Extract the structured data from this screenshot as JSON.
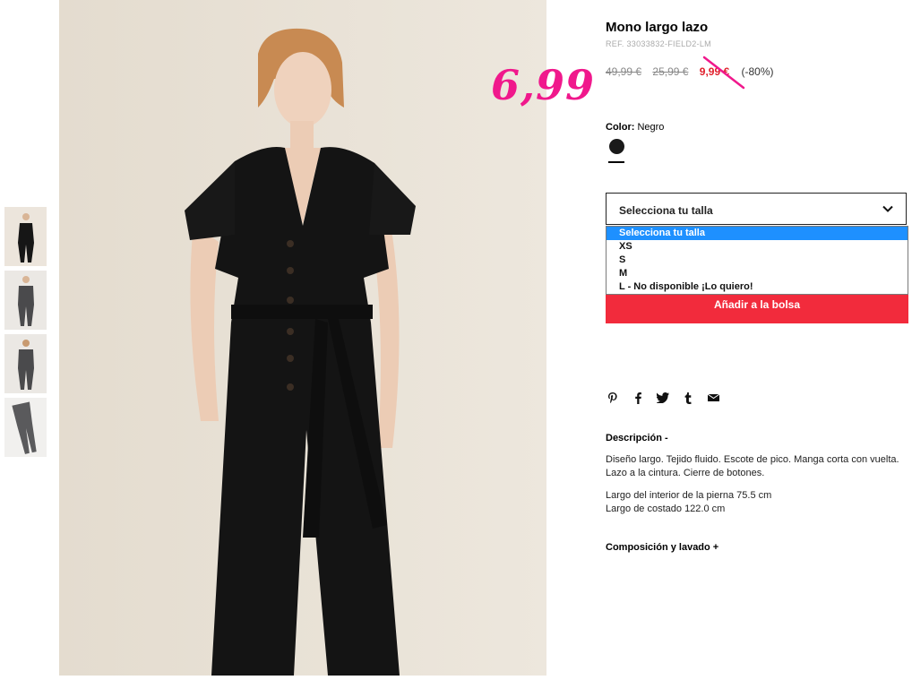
{
  "promo": {
    "price": "6,99"
  },
  "product": {
    "title": "Mono largo lazo",
    "ref": "REF. 33033832-FIELD2-LM",
    "prices": {
      "original": "49,99 €",
      "previous": "25,99 €",
      "current": "9,99 €",
      "discount": "(-80%)"
    },
    "color": {
      "label": "Color:",
      "value": "Negro",
      "swatch": "#1a1a1a"
    }
  },
  "size_select": {
    "placeholder": "Selecciona tu talla",
    "options": [
      "Selecciona tu talla",
      "XS",
      "S",
      "M",
      "L - No disponible ¡Lo quiero!"
    ]
  },
  "add_to_bag": "Añadir a la bolsa",
  "share_icons": [
    "pinterest-icon",
    "facebook-icon",
    "twitter-icon",
    "tumblr-icon",
    "email-icon"
  ],
  "description": {
    "heading": "Descripción -",
    "text": "Diseño largo. Tejido fluido. Escote de pico. Manga corta con vuelta. Lazo a la cintura. Cierre de botones.",
    "inseam": "Largo del interior de la pierna 75.5 cm",
    "side": "Largo de costado 122.0 cm"
  },
  "composition_heading": "Composición y lavado +",
  "colors": {
    "accent_red": "#f22b3c",
    "promo_pink": "#f0188c",
    "price_red": "#e01f2b",
    "select_blue": "#1e90ff"
  }
}
